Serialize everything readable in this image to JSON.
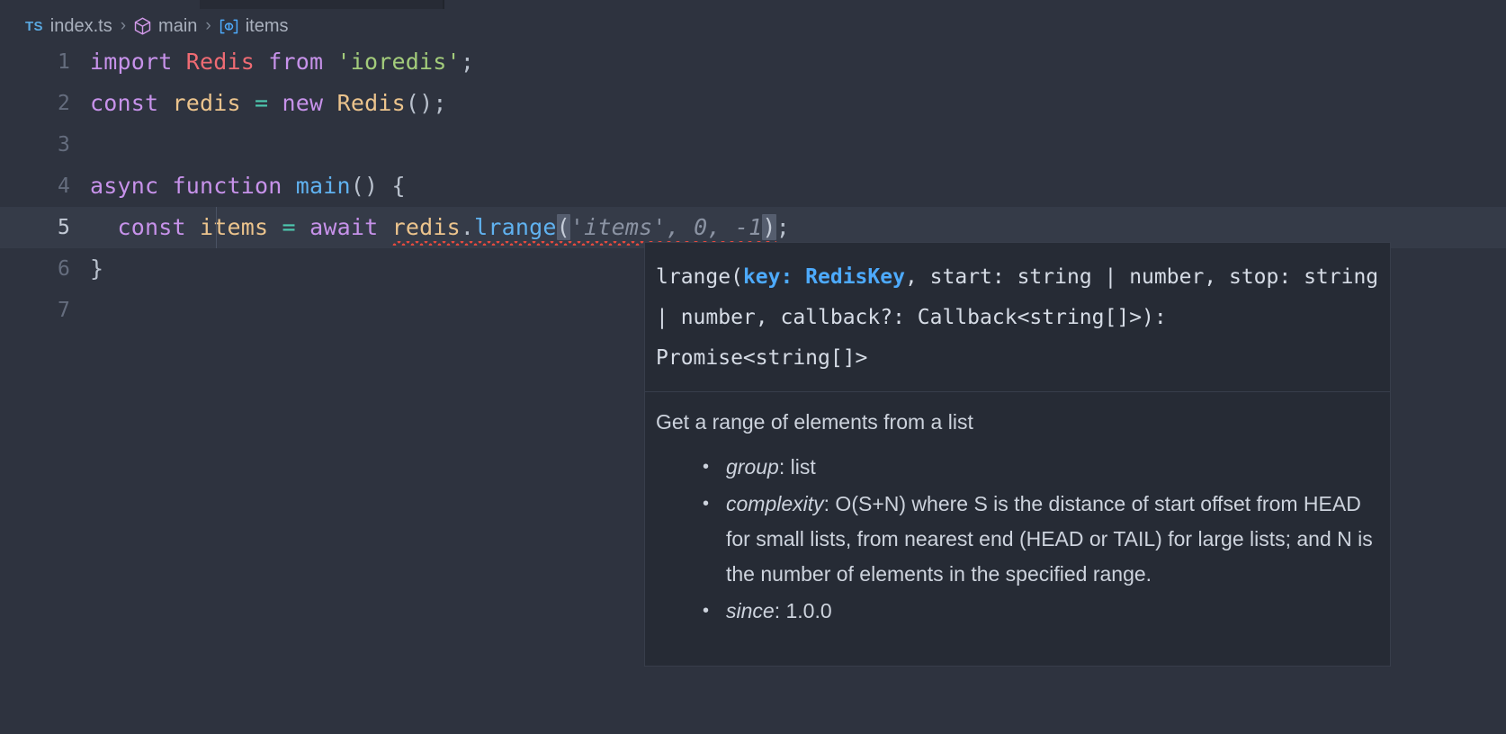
{
  "window": {
    "background": "#2e333f",
    "tab_background": "#272b35"
  },
  "breadcrumb": {
    "file_badge": "TS",
    "file_name": "index.ts",
    "separator": "›",
    "symbol_function": "main",
    "symbol_variable": "items",
    "icons": {
      "file_type": "typescript-badge-icon",
      "function": "cube-icon",
      "variable": "field-icon"
    }
  },
  "editor": {
    "active_line": 5,
    "lines": [
      {
        "number": "1",
        "tokens": [
          {
            "text": "import ",
            "kind": "kw"
          },
          {
            "text": "Redis",
            "kind": "cls"
          },
          {
            "text": " from ",
            "kind": "kw"
          },
          {
            "text": "'ioredis'",
            "kind": "str"
          },
          {
            "text": ";",
            "kind": "punc"
          }
        ]
      },
      {
        "number": "2",
        "tokens": [
          {
            "text": "const ",
            "kind": "kw"
          },
          {
            "text": "redis ",
            "kind": "var"
          },
          {
            "text": "= ",
            "kind": "op"
          },
          {
            "text": "new ",
            "kind": "kw"
          },
          {
            "text": "Redis",
            "kind": "var"
          },
          {
            "text": "();",
            "kind": "punc"
          }
        ]
      },
      {
        "number": "3",
        "tokens": []
      },
      {
        "number": "4",
        "tokens": [
          {
            "text": "async function ",
            "kind": "kw"
          },
          {
            "text": "main",
            "kind": "fn"
          },
          {
            "text": "() {",
            "kind": "punc"
          }
        ]
      },
      {
        "number": "5",
        "tokens": [
          {
            "text": "  ",
            "kind": "punc"
          },
          {
            "text": "const ",
            "kind": "kw"
          },
          {
            "text": "items ",
            "kind": "var"
          },
          {
            "text": "= ",
            "kind": "op"
          },
          {
            "text": "await ",
            "kind": "kw"
          },
          {
            "text": "redis",
            "kind": "var"
          },
          {
            "text": ".",
            "kind": "punc"
          },
          {
            "text": "lrange",
            "kind": "fn"
          },
          {
            "text": "(",
            "kind": "brkt"
          },
          {
            "text": "'items', 0, -1",
            "kind": "ghost"
          },
          {
            "text": ")",
            "kind": "brkt"
          },
          {
            "text": ";",
            "kind": "punc"
          }
        ]
      },
      {
        "number": "6",
        "tokens": [
          {
            "text": "}",
            "kind": "punc"
          }
        ]
      },
      {
        "number": "7",
        "tokens": []
      }
    ]
  },
  "tooltip": {
    "signature": {
      "prefix": "lrange(",
      "active_param": "key: RedisKey",
      "suffix": ", start: string | number, stop: string | number, callback?: Callback<string[]>): Promise<string[]>"
    },
    "description": "Get a range of elements from a list",
    "items": [
      {
        "key": "group",
        "value": ": list"
      },
      {
        "key": "complexity",
        "value": ": O(S+N) where S is the distance of start offset from HEAD for small lists, from nearest end (HEAD or TAIL) for large lists; and N is the number of elements in the specified range."
      },
      {
        "key": "since",
        "value": ": 1.0.0"
      }
    ]
  },
  "colors": {
    "keyword": "#c792ea",
    "class": "#ef6b73",
    "string": "#a3cc7b",
    "variable": "#ecc48d",
    "operator": "#4ec9b0",
    "function": "#60b2f0",
    "ghost_text": "#8b93a3",
    "error_squiggle": "#e04a3f",
    "active_param": "#4daafc",
    "active_line_bg": "#353b48"
  }
}
